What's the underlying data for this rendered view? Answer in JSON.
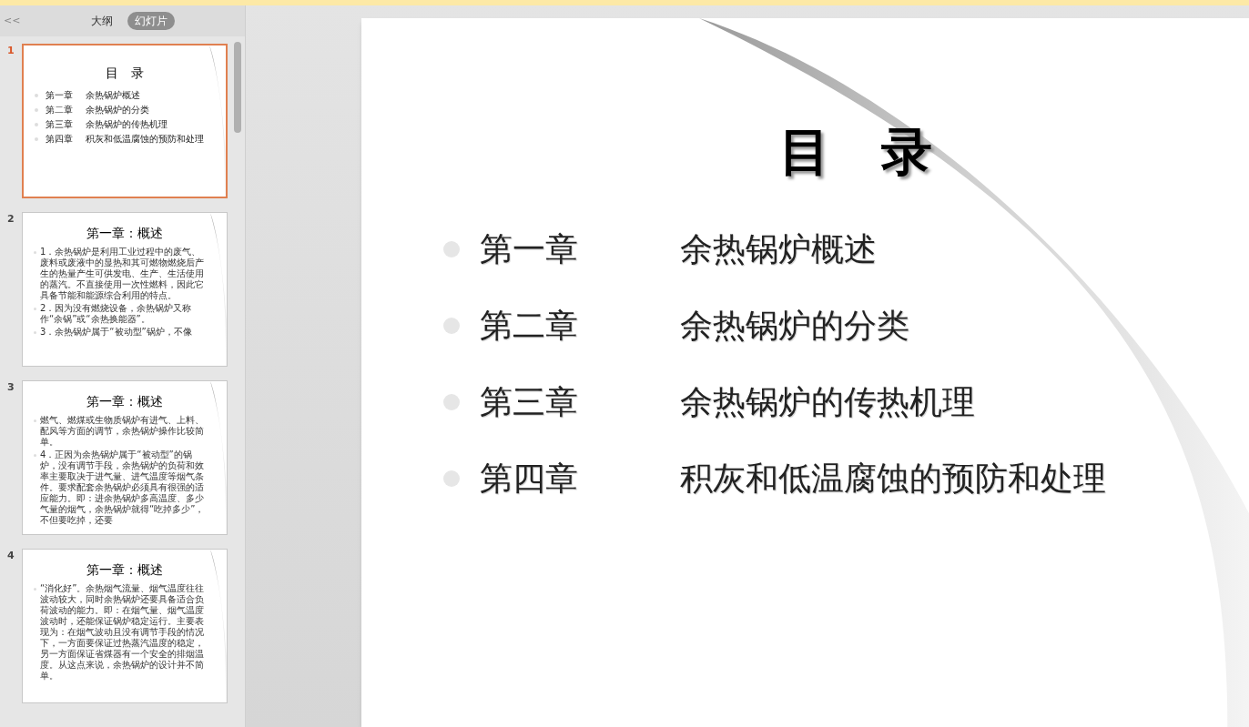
{
  "sidebar": {
    "collapse": "<<",
    "tabs": [
      {
        "label": "大纲",
        "selected": false
      },
      {
        "label": "幻灯片",
        "selected": true
      }
    ],
    "slides": [
      {
        "number": "1",
        "selected": true,
        "kind": "toc",
        "title": "目　录",
        "items": [
          {
            "chapter": "第一章",
            "name": "余热锅炉概述"
          },
          {
            "chapter": "第二章",
            "name": "余热锅炉的分类"
          },
          {
            "chapter": "第三章",
            "name": "余热锅炉的传热机理"
          },
          {
            "chapter": "第四章",
            "name": "积灰和低温腐蚀的预防和处理"
          }
        ]
      },
      {
        "number": "2",
        "selected": false,
        "kind": "text",
        "title": "第一章：概述",
        "paragraphs": [
          "1．余热锅炉是利用工业过程中的废气、废料或废液中的显热和其可燃物燃烧后产生的热量产生可供发电、生产、生活使用的蒸汽。不直接使用一次性燃料，因此它具备节能和能源综合利用的特点。",
          "2．因为没有燃烧设备，余热锅炉又称作“余锅”或“余热换能器”。",
          "3．余热锅炉属于“被动型”锅炉，不像"
        ]
      },
      {
        "number": "3",
        "selected": false,
        "kind": "text",
        "title": "第一章：概述",
        "paragraphs": [
          "燃气、燃煤或生物质锅炉有进气、上料、配风等方面的调节，余热锅炉操作比较简单。",
          "4．正因为余热锅炉属于“被动型”的锅炉，没有调节手段，余热锅炉的负荷和效率主要取决于进气量、进气温度等烟气条件。要求配套余热锅炉必须具有很强的适应能力。即：进余热锅炉多高温度、多少气量的烟气，余热锅炉就得“吃掉多少”，不但要吃掉，还要"
        ]
      },
      {
        "number": "4",
        "selected": false,
        "kind": "text",
        "title": "第一章：概述",
        "paragraphs": [
          "“消化好”。余热烟气流量、烟气温度往往波动较大，同时余热锅炉还要具备适合负荷波动的能力。即：在烟气量、烟气温度波动时，还能保证锅炉稳定运行。主要表现为：在烟气波动且没有调节手段的情况下，一方面要保证过热蒸汽温度的稳定，另一方面保证省煤器有一个安全的排烟温度。从这点来说，余热锅炉的设计并不简单。"
        ]
      }
    ]
  },
  "slide": {
    "title": "目　录",
    "items": [
      {
        "chapter": "第一章",
        "name": "余热锅炉概述"
      },
      {
        "chapter": "第二章",
        "name": "余热锅炉的分类"
      },
      {
        "chapter": "第三章",
        "name": "余热锅炉的传热机理"
      },
      {
        "chapter": "第四章",
        "name": "积灰和低温腐蚀的预防和处理"
      }
    ]
  }
}
